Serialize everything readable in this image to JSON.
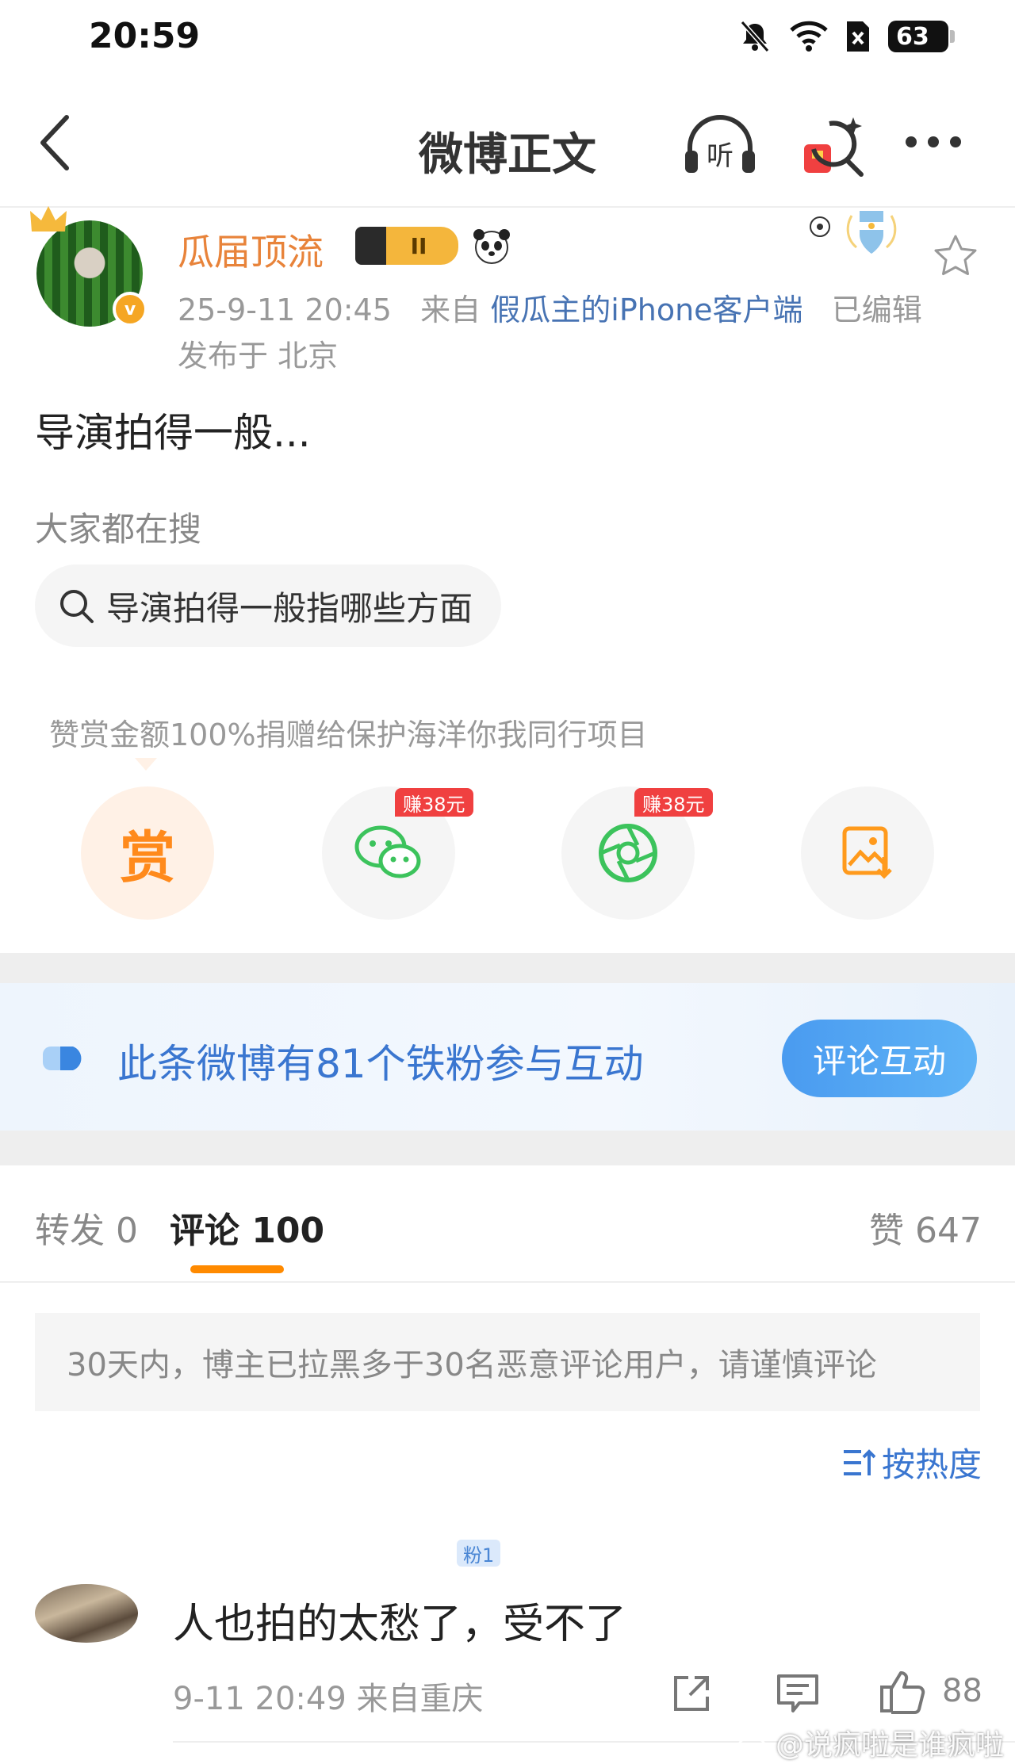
{
  "status_bar": {
    "time": "20:59",
    "battery": "63"
  },
  "header": {
    "title": "微博正文",
    "listen_label": "听"
  },
  "author": {
    "name": "瓜届顶流",
    "level": "II",
    "verified_mark": "v",
    "date": "25-9-11 20:45",
    "source_prefix": "来自",
    "source": "假瓜主的iPhone客户端",
    "edited": "已编辑",
    "location": "发布于 北京"
  },
  "post": {
    "text": "导演拍得一般..."
  },
  "everyone_search": {
    "title": "大家都在搜",
    "query": "导演拍得一般指哪些方面"
  },
  "reward": {
    "note": "赞赏金额100%捐赠给保护海洋你我同行项目",
    "reward_char": "赏"
  },
  "share_actions": {
    "wechat_tag": "赚38元",
    "moments_tag": "赚38元"
  },
  "banner": {
    "text": "此条微博有81个铁粉参与互动",
    "button": "评论互动"
  },
  "tabs": {
    "repost": "转发 0",
    "comment": "评论 100",
    "like": "赞 647"
  },
  "warning": "30天内，博主已拉黑多于30名恶意评论用户，请谨慎评论",
  "sort": {
    "label": "按热度"
  },
  "comment": {
    "fan_badge": "粉1",
    "text": "人也拍的太愁了，受不了",
    "meta": "9-11 20:49 来自重庆",
    "likes": "88"
  },
  "watermark": "@说疯啦是谁疯啦",
  "colors": {
    "accent_orange": "#ff8a00",
    "name_orange": "#e8833a",
    "link_blue": "#3a76d0",
    "earn_red": "#f04040",
    "wechat_green": "#3cc35c"
  },
  "icons": [
    "back-icon",
    "headphones-icon",
    "ai-search-icon",
    "more-icon",
    "star-icon",
    "search-icon",
    "wechat-icon",
    "moments-icon",
    "save-image-icon",
    "sort-icon",
    "share-icon",
    "reply-icon",
    "like-icon",
    "weibo-logo-icon"
  ]
}
